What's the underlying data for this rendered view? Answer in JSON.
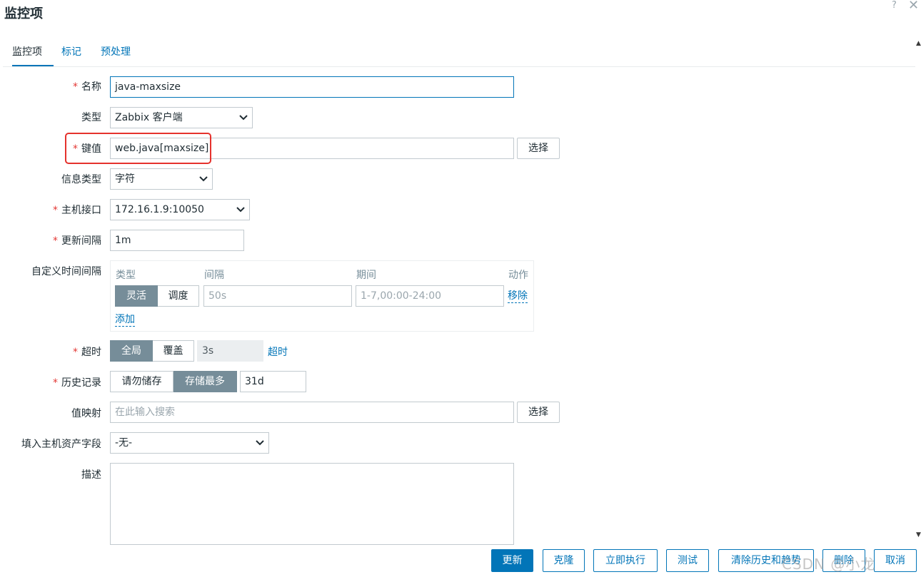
{
  "dialog": {
    "title": "监控项",
    "help_glyph": "?",
    "close_glyph": "✕"
  },
  "tabs": [
    {
      "label": "监控项",
      "active": true
    },
    {
      "label": "标记",
      "active": false
    },
    {
      "label": "预处理",
      "active": false
    }
  ],
  "form": {
    "name": {
      "label": "名称",
      "required": true,
      "value": "java-maxsize"
    },
    "type": {
      "label": "类型",
      "value": "Zabbix 客户端"
    },
    "key": {
      "label": "键值",
      "required": true,
      "value": "web.java[maxsize]",
      "select_button": "选择"
    },
    "value_type": {
      "label": "信息类型",
      "value": "字符"
    },
    "host_interface": {
      "label": "主机接口",
      "required": true,
      "value": "172.16.1.9:10050"
    },
    "update_interval": {
      "label": "更新间隔",
      "required": true,
      "value": "1m"
    },
    "custom_intervals": {
      "label": "自定义时间间隔",
      "headers": {
        "type": "类型",
        "interval": "间隔",
        "period": "期间",
        "action": "动作"
      },
      "row": {
        "mode_flexible": "灵活",
        "mode_scheduling": "调度",
        "mode_selected": "flexible",
        "interval_placeholder": "50s",
        "period_placeholder": "1-7,00:00-24:00",
        "remove_link": "移除"
      },
      "add_link": "添加"
    },
    "timeout": {
      "label": "超时",
      "required": true,
      "global": "全局",
      "override": "覆盖",
      "selected": "global",
      "value": "3s",
      "link": "超时"
    },
    "history": {
      "label": "历史记录",
      "required": true,
      "do_not_store": "请勿储存",
      "store_up_to": "存储最多",
      "selected": "store_up_to",
      "value": "31d"
    },
    "value_mapping": {
      "label": "值映射",
      "placeholder": "在此输入搜索",
      "select_button": "选择"
    },
    "inventory_field": {
      "label": "填入主机资产字段",
      "value": "-无-"
    },
    "description": {
      "label": "描述",
      "value": ""
    }
  },
  "footer": {
    "update": "更新",
    "clone": "克隆",
    "execute_now": "立即执行",
    "test": "测试",
    "clear_history": "清除历史和趋势",
    "delete": "删除",
    "cancel": "取消"
  },
  "watermark": "CSDN @小龙",
  "colors": {
    "accent": "#0275b8",
    "required": "#e33734",
    "annotation": "#e5322d",
    "toggle_on": "#768d99"
  }
}
